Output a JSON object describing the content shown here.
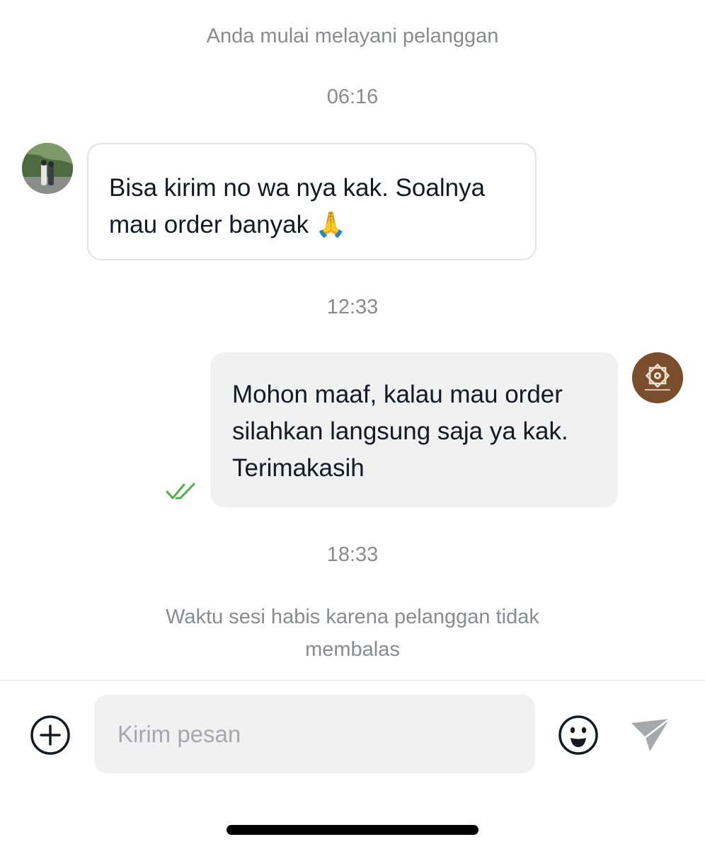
{
  "conversation": {
    "session_started": "Anda mulai melayani pelanggan",
    "time_1": "06:16",
    "customer_message_lines": [
      "Bisa kirim no wa nya kak. Soalnya",
      "mau order banyak 🙏"
    ],
    "time_2": "12:33",
    "seller_message_lines": [
      "Mohon maaf, kalau mau order",
      "silahkan langsung saja ya kak.",
      "Terimakasih"
    ],
    "time_3": "18:33",
    "session_expired_lines": [
      "Waktu sesi habis karena pelanggan tidak",
      "membalas"
    ]
  },
  "composer": {
    "placeholder": "Kirim pesan"
  },
  "colors": {
    "read_check": "#4fb04a",
    "seller_avatar": "#7a4e2d",
    "bubble_out_bg": "#f1f1f2",
    "send_icon": "#a7a8ab"
  },
  "icons": {
    "attach": "plus-circle-icon",
    "emoji": "smiley-face-icon",
    "send": "paper-plane-icon",
    "read_status": "double-check-icon"
  }
}
